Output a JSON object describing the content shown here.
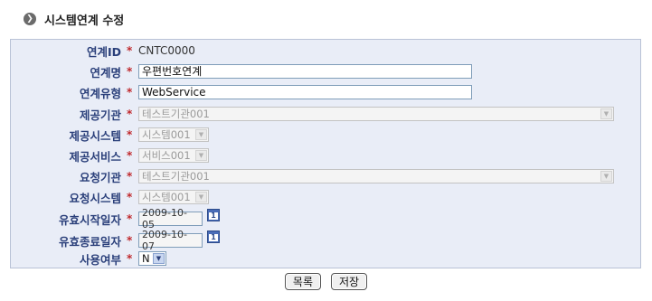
{
  "page": {
    "title": "시스템연계 수정"
  },
  "form": {
    "required_mark": "*",
    "fields": [
      {
        "label": "연계ID",
        "value": "CNTC0000"
      },
      {
        "label": "연계명",
        "value": "우편번호연계"
      },
      {
        "label": "연계유형",
        "value": "WebService"
      },
      {
        "label": "제공기관",
        "value": "테스트기관001"
      },
      {
        "label": "제공시스템",
        "value": "시스템001"
      },
      {
        "label": "제공서비스",
        "value": "서비스001"
      },
      {
        "label": "요청기관",
        "value": "테스트기관001"
      },
      {
        "label": "요청시스템",
        "value": "시스템001"
      },
      {
        "label": "유효시작일자",
        "value": "2009-10-05"
      },
      {
        "label": "유효종료일자",
        "value": "2009-10-07"
      },
      {
        "label": "사용여부",
        "value": "N"
      }
    ]
  },
  "buttons": {
    "list": "목록",
    "save": "저장"
  },
  "icons": {
    "title": "chevron-circle-icon",
    "calendar": "calendar-icon",
    "dropdown": "dropdown-arrow-icon"
  },
  "colors": {
    "label": "#2a3f7a",
    "required": "#c0282b",
    "panel_bg": "#e9edf7",
    "panel_border": "#b9c2d6"
  }
}
